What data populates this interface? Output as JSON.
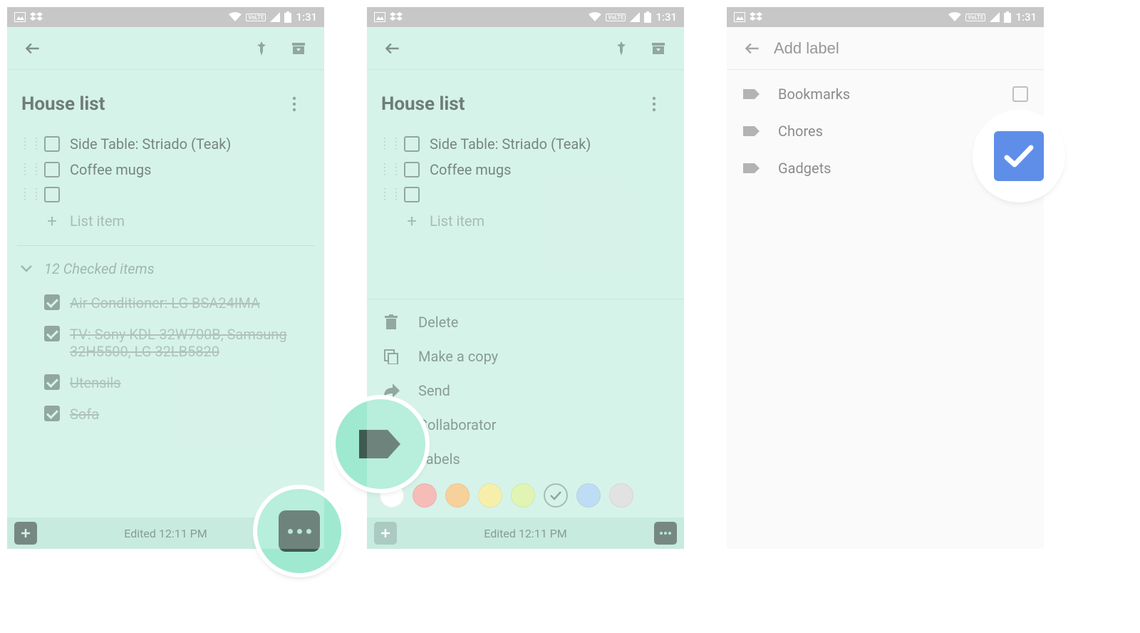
{
  "status": {
    "time": "1:31",
    "volte": "VoLTE"
  },
  "note": {
    "title": "House list",
    "items": [
      {
        "label": "Side Table: Striado (Teak)"
      },
      {
        "label": "Coffee mugs"
      },
      {
        "label": ""
      }
    ],
    "add_item_placeholder": "List item",
    "checked_header": "12 Checked items",
    "checked_items": [
      "Air Conditioner: LG BSA24IMA",
      "TV: Sony KDL-32W700B, Samsung 32H5500, LG 32LB5820",
      "Utensils",
      "Sofa"
    ],
    "footer": {
      "edited": "Edited 12:11 PM"
    }
  },
  "menu": {
    "items": [
      {
        "label": "Delete",
        "icon": "trash"
      },
      {
        "label": "Make a copy",
        "icon": "copy"
      },
      {
        "label": "Send",
        "icon": "share"
      },
      {
        "label": "Collaborator",
        "icon": "person-plus"
      },
      {
        "label": "Labels",
        "icon": "tag"
      }
    ],
    "colors": [
      "#ffffff",
      "#f3a6a0",
      "#f4c27a",
      "#f3ea91",
      "#d6f29a",
      "#c9efe2",
      "#a9d2f0",
      "#d9d9d9"
    ]
  },
  "labels": {
    "placeholder": "Add label",
    "items": [
      "Bookmarks",
      "Chores",
      "Gadgets"
    ],
    "checked_index": 1
  }
}
